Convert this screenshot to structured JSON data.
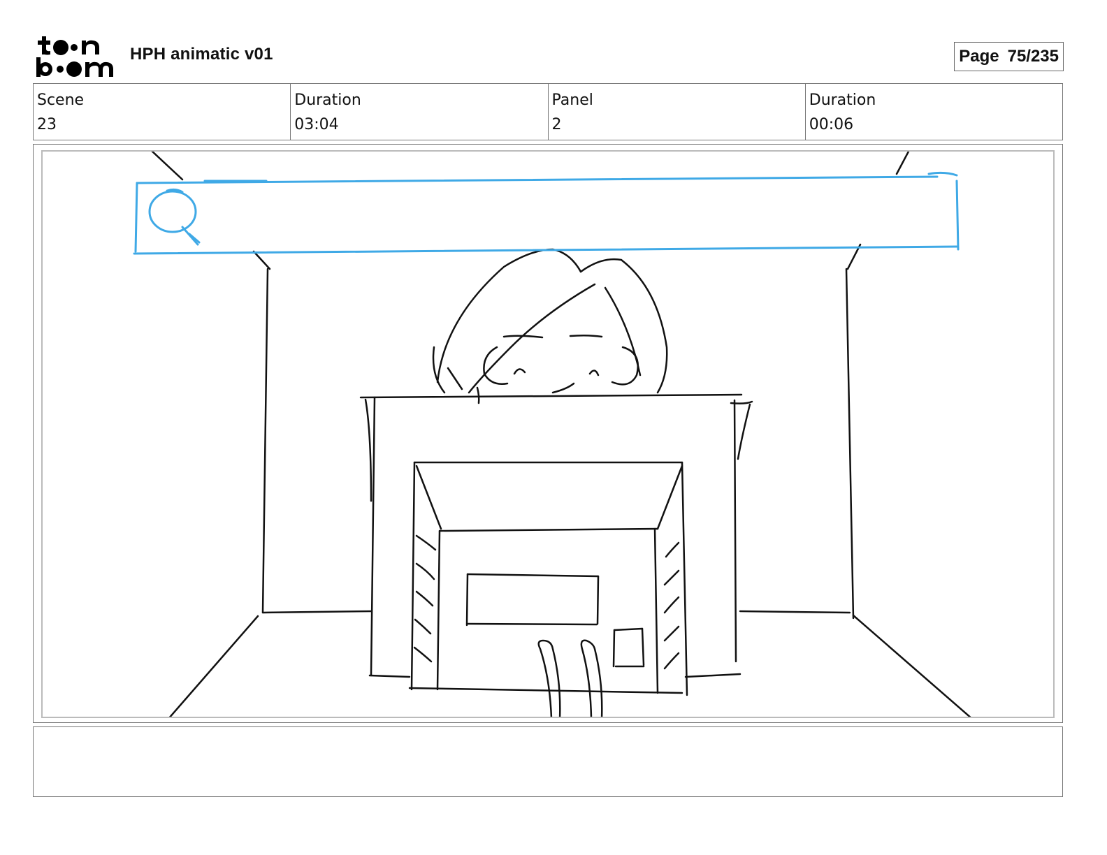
{
  "header": {
    "logo_text_top": "to•n",
    "logo_text_bottom": "b••m",
    "title": "HPH animatic v01",
    "page_label": "Page",
    "page_number": "75/235"
  },
  "info": [
    {
      "label": "Scene",
      "value": "23"
    },
    {
      "label": "Duration",
      "value": "03:04"
    },
    {
      "label": "Panel",
      "value": "2"
    },
    {
      "label": "Duration",
      "value": "00:06"
    }
  ],
  "colors": {
    "sketch_line": "#111111",
    "search_bar": "#3fa9e6",
    "frame_border": "#777777"
  },
  "icons": {
    "logo": "toonboom-logo",
    "search": "magnifier-icon"
  },
  "notes": ""
}
